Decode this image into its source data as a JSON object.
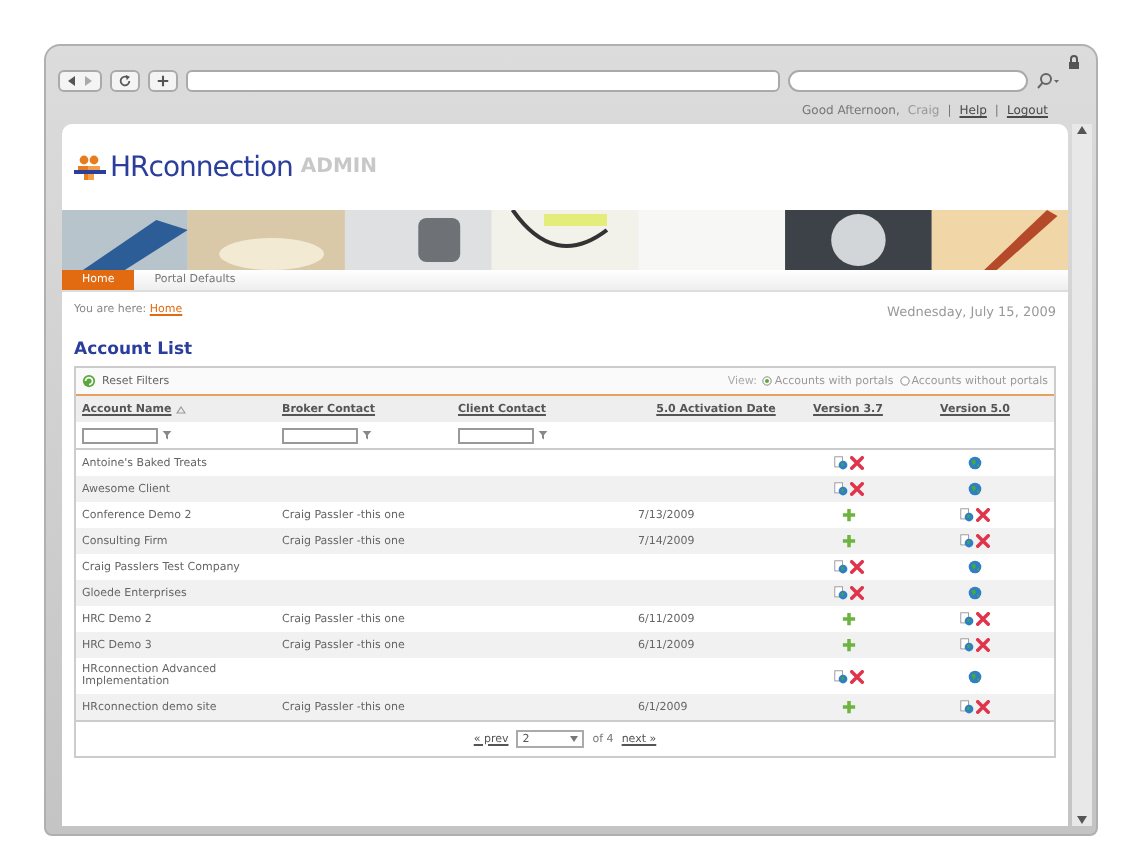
{
  "top_bar": [
    {
      "kind": "text",
      "text": "Good Afternoon,"
    },
    {
      "kind": "user",
      "text": "Craig"
    },
    {
      "kind": "sep",
      "text": "|"
    },
    {
      "kind": "link",
      "text": "Help"
    },
    {
      "kind": "sep",
      "text": "|"
    },
    {
      "kind": "link",
      "text": "Logout"
    }
  ],
  "logo": {
    "name": "HRconnection",
    "suffix": "ADMIN"
  },
  "tabs": [
    {
      "label": "Home",
      "selected": true
    },
    {
      "label": "Portal Defaults",
      "selected": false
    }
  ],
  "breadcrumb": {
    "prefix": "You are here:",
    "link": "Home"
  },
  "date": "Wednesday, July 15, 2009",
  "title": "Account List",
  "reset_filters": "Reset Filters",
  "view": {
    "label": "View:",
    "options": [
      {
        "label": "Accounts with portals",
        "selected": true
      },
      {
        "label": "Accounts without portals",
        "selected": false
      }
    ]
  },
  "table": {
    "columns": [
      {
        "label": "Account Name",
        "sorted": true,
        "filter": true
      },
      {
        "label": "Broker Contact",
        "sorted": false,
        "filter": true
      },
      {
        "label": "Client Contact",
        "sorted": false,
        "filter": true
      },
      {
        "label": "5.0 Activation Date",
        "sorted": false,
        "filter": false
      },
      {
        "label": "Version 3.7",
        "sorted": false,
        "filter": false
      },
      {
        "label": "Version 5.0",
        "sorted": false,
        "filter": false
      }
    ],
    "rows": [
      {
        "account": "Antoine's Baked Treats",
        "broker": "",
        "date": "",
        "v37": {
          "kind": "portal"
        },
        "v50": {
          "kind": "globe"
        }
      },
      {
        "account": "Awesome Client",
        "broker": "",
        "date": "",
        "v37": {
          "kind": "portal"
        },
        "v50": {
          "kind": "globe"
        }
      },
      {
        "account": "Conference Demo 2",
        "broker": "Craig Passler -this one",
        "date": "7/13/2009",
        "v37": {
          "kind": "add"
        },
        "v50": {
          "kind": "portal"
        }
      },
      {
        "account": "Consulting Firm",
        "broker": "Craig Passler -this one",
        "date": "7/14/2009",
        "v37": {
          "kind": "add"
        },
        "v50": {
          "kind": "portal"
        }
      },
      {
        "account": "Craig Passlers Test Company",
        "broker": "",
        "date": "",
        "v37": {
          "kind": "portal"
        },
        "v50": {
          "kind": "globe"
        }
      },
      {
        "account": "Gloede Enterprises",
        "broker": "",
        "date": "",
        "v37": {
          "kind": "portal"
        },
        "v50": {
          "kind": "globe"
        }
      },
      {
        "account": "HRC Demo 2",
        "broker": "Craig Passler -this one",
        "date": "6/11/2009",
        "v37": {
          "kind": "add"
        },
        "v50": {
          "kind": "portal"
        }
      },
      {
        "account": "HRC Demo 3",
        "broker": "Craig Passler -this one",
        "date": "6/11/2009",
        "v37": {
          "kind": "add"
        },
        "v50": {
          "kind": "portal"
        }
      },
      {
        "account": "HRconnection Advanced Implementation",
        "broker": "",
        "date": "",
        "v37": {
          "kind": "portal"
        },
        "v50": {
          "kind": "globe"
        }
      },
      {
        "account": "HRconnection demo site",
        "broker": "Craig Passler -this one",
        "date": "6/1/2009",
        "v37": {
          "kind": "add"
        },
        "v50": {
          "kind": "portal"
        }
      }
    ]
  },
  "pager": {
    "prev": "« prev",
    "page": "2",
    "of": "of 4",
    "next": "next »"
  }
}
